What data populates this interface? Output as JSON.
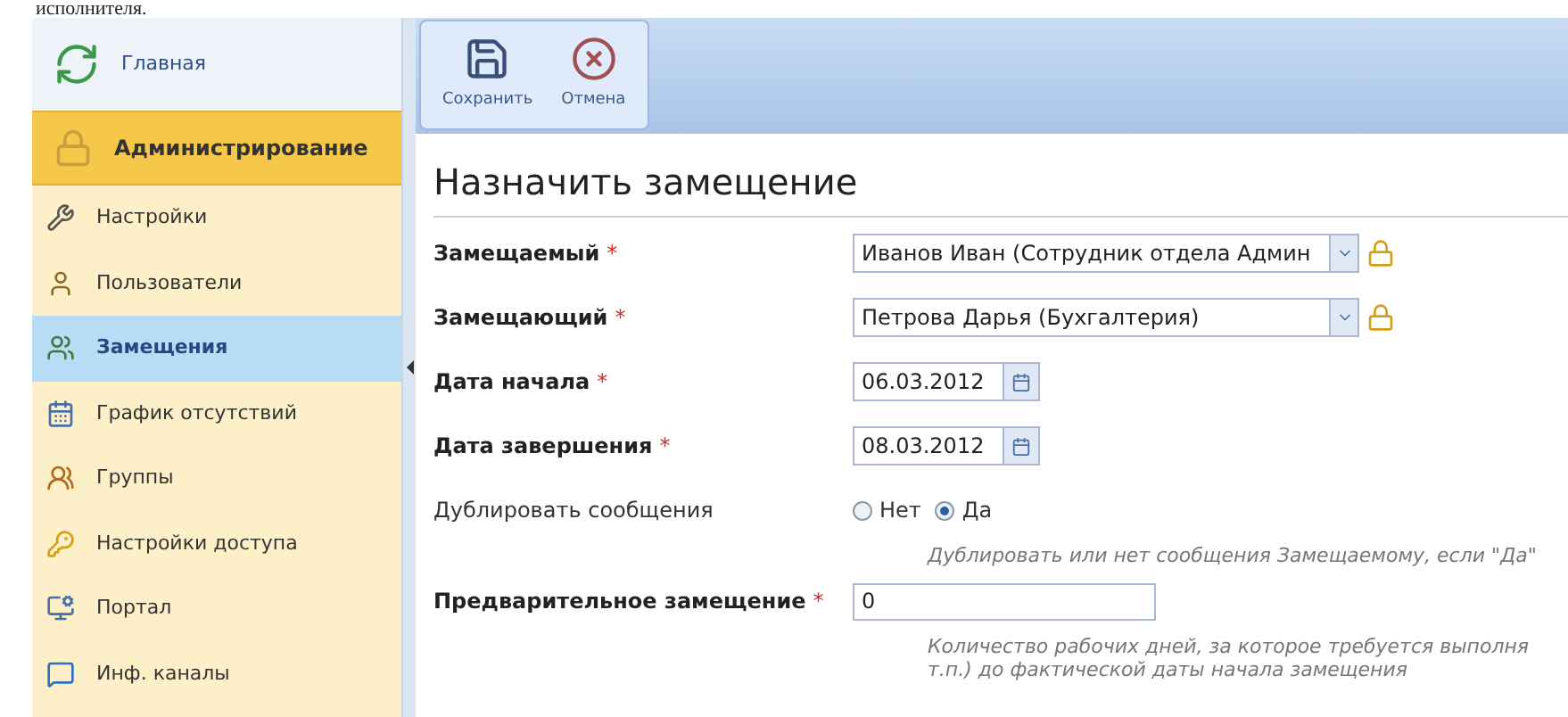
{
  "document_text": "исполнителя.",
  "sidebar": {
    "home": {
      "label": "Главная"
    },
    "section": {
      "label": "Администрирование"
    },
    "items": [
      {
        "label": "Настройки",
        "selected": false
      },
      {
        "label": "Пользователи",
        "selected": false
      },
      {
        "label": "Замещения",
        "selected": true
      },
      {
        "label": "График отсутствий",
        "selected": false
      },
      {
        "label": "Группы",
        "selected": false
      },
      {
        "label": "Настройки доступа",
        "selected": false
      },
      {
        "label": "Портал",
        "selected": false
      },
      {
        "label": "Инф. каналы",
        "selected": false
      }
    ]
  },
  "toolbar": [
    {
      "label": "Сохранить",
      "kind": "save"
    },
    {
      "label": "Отмена",
      "kind": "cancel"
    }
  ],
  "title": "Назначить замещение",
  "form": [
    {
      "kind": "select",
      "label": "Замещаемый",
      "required_mark": "*",
      "value": "Иванов Иван (Сотрудник отдела Админ"
    },
    {
      "kind": "select",
      "label": "Замещающий",
      "required_mark": "*",
      "value": "Петрова Дарья (Бухгалтерия)"
    },
    {
      "kind": "date",
      "label": "Дата начала",
      "required_mark": "*",
      "value": "06.03.2012"
    },
    {
      "kind": "date",
      "label": "Дата завершения",
      "required_mark": "*",
      "value": "08.03.2012"
    },
    {
      "kind": "radio",
      "label": "Дублировать сообщения",
      "options": [
        {
          "label": "Нет",
          "selected": false
        },
        {
          "label": "Да",
          "selected": true
        }
      ],
      "hint": [
        "Дублировать или нет сообщения Замещаемому, если \"Да\""
      ]
    },
    {
      "kind": "text",
      "label": "Предварительное замещение",
      "required_mark": "*",
      "value": "0",
      "hint": [
        "Количество рабочих дней, за которое требуется выполня",
        "т.п.) до фактической даты начала замещения"
      ]
    }
  ]
}
